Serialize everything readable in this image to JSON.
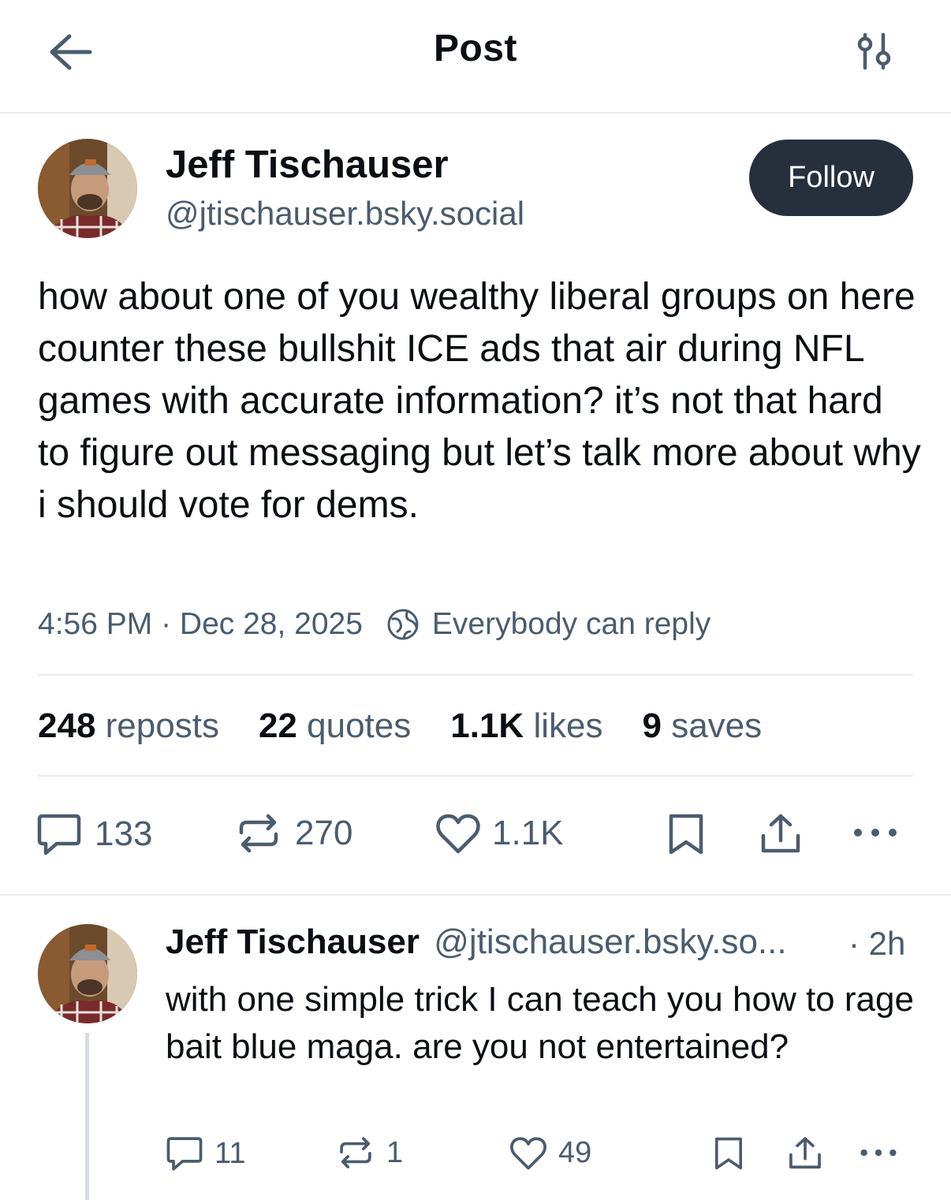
{
  "header": {
    "title": "Post",
    "back_icon": "arrow-left-icon",
    "settings_icon": "sliders-icon"
  },
  "post": {
    "author_name": "Jeff Tischauser",
    "author_handle": "@jtischauser.bsky.social",
    "follow_label": "Follow",
    "text": "how about one of you wealthy liberal groups on here counter these bullshit ICE ads that air during NFL games with accurate information? it’s not that hard to figure out messaging but let’s talk more about why i should vote for dems.",
    "timestamp": "4:56 PM · Dec 28, 2025",
    "reply_setting": "Everybody can reply",
    "stats": {
      "reposts_count": "248",
      "reposts_label": "reposts",
      "quotes_count": "22",
      "quotes_label": "quotes",
      "likes_count": "1.1K",
      "likes_label": "likes",
      "saves_count": "9",
      "saves_label": "saves"
    },
    "actions": {
      "replies": "133",
      "reposts": "270",
      "likes": "1.1K"
    }
  },
  "reply": {
    "author_name": "Jeff Tischauser",
    "author_handle": "@jtischauser.bsky.so...",
    "time": "· 2h",
    "text": "with one simple trick I can teach you how to rage bait blue maga. are you not entertained?",
    "actions": {
      "replies": "11",
      "reposts": "1",
      "likes": "49"
    }
  },
  "colors": {
    "text": "#0b0f14",
    "muted": "#4b5c6e",
    "follow_bg": "#26303d",
    "divider": "#e9edf1"
  }
}
